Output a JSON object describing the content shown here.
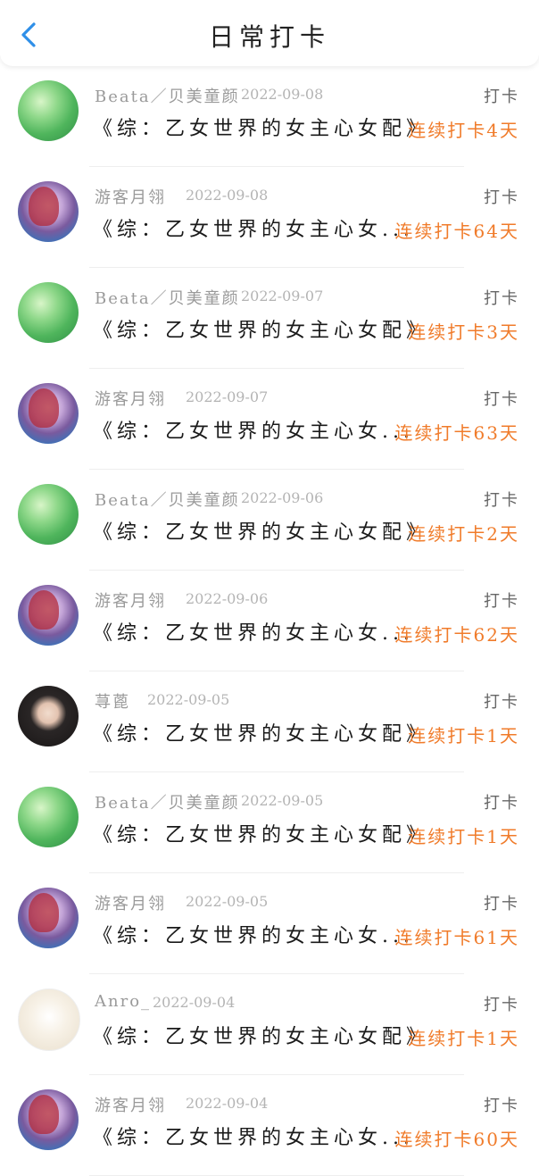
{
  "header": {
    "title": "日常打卡"
  },
  "colors": {
    "accent": "#2f8fe8",
    "streak": "#f07b2a"
  },
  "rows": [
    {
      "avatar": "green",
      "name": "Beata／贝美童颜",
      "date": "2022-09-08",
      "checkin": "打卡",
      "content": "《综：乙女世界的女主心女配》",
      "streak": "连续打卡4天"
    },
    {
      "avatar": "anime",
      "name": "游客月翎",
      "date": "2022-09-08",
      "checkin": "打卡",
      "content": "《综：乙女世界的女主心女...",
      "streak": "连续打卡64天"
    },
    {
      "avatar": "green",
      "name": "Beata／贝美童颜",
      "date": "2022-09-07",
      "checkin": "打卡",
      "content": "《综：乙女世界的女主心女配》",
      "streak": "连续打卡3天"
    },
    {
      "avatar": "anime",
      "name": "游客月翎",
      "date": "2022-09-07",
      "checkin": "打卡",
      "content": "《综：乙女世界的女主心女...",
      "streak": "连续打卡63天"
    },
    {
      "avatar": "green",
      "name": "Beata／贝美童颜",
      "date": "2022-09-06",
      "checkin": "打卡",
      "content": "《综：乙女世界的女主心女配》",
      "streak": "连续打卡2天"
    },
    {
      "avatar": "anime",
      "name": "游客月翎",
      "date": "2022-09-06",
      "checkin": "打卡",
      "content": "《综：乙女世界的女主心女...",
      "streak": "连续打卡62天"
    },
    {
      "avatar": "photo",
      "name": "荨蓖",
      "date": "2022-09-05",
      "checkin": "打卡",
      "content": "《综：乙女世界的女主心女配》",
      "streak": "连续打卡1天"
    },
    {
      "avatar": "green",
      "name": "Beata／贝美童颜",
      "date": "2022-09-05",
      "checkin": "打卡",
      "content": "《综：乙女世界的女主心女配》",
      "streak": "连续打卡1天"
    },
    {
      "avatar": "anime",
      "name": "游客月翎",
      "date": "2022-09-05",
      "checkin": "打卡",
      "content": "《综：乙女世界的女主心女...",
      "streak": "连续打卡61天"
    },
    {
      "avatar": "cute",
      "name": "Anro_",
      "date": "2022-09-04",
      "checkin": "打卡",
      "content": "《综：乙女世界的女主心女配》",
      "streak": "连续打卡1天"
    },
    {
      "avatar": "anime",
      "name": "游客月翎",
      "date": "2022-09-04",
      "checkin": "打卡",
      "content": "《综：乙女世界的女主心女...",
      "streak": "连续打卡60天"
    }
  ]
}
